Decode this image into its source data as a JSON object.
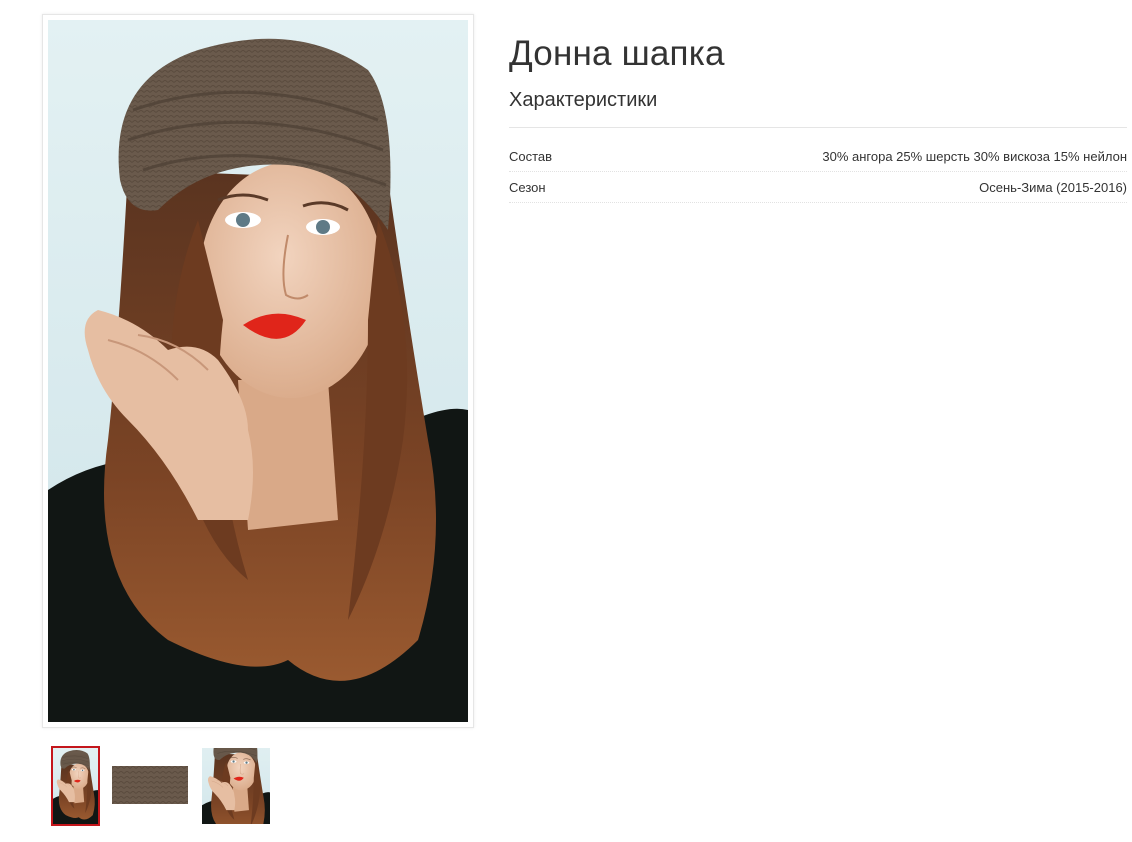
{
  "product": {
    "title": "Донна шапка",
    "photo": "woman-in-brown-knit-hat-photo"
  },
  "characteristics": {
    "heading": "Характеристики",
    "rows": [
      {
        "label": "Состав",
        "value": "30% ангора 25% шерсть 30% вискоза 15% нейлон"
      },
      {
        "label": "Сезон",
        "value": "Осень-Зима (2015-2016)"
      }
    ]
  },
  "gallery": {
    "selected_index": 0,
    "thumbnails": [
      "model-photo-thumbnail",
      "knit-fabric-swatch-thumbnail",
      "model-photo-thumbnail"
    ]
  },
  "colors": {
    "accent": "#c4161c",
    "background": "#ffffff",
    "text": "#333333",
    "hat": "#6a5a4c",
    "backdrop": "#d9ecef",
    "lips": "#e0251a"
  }
}
